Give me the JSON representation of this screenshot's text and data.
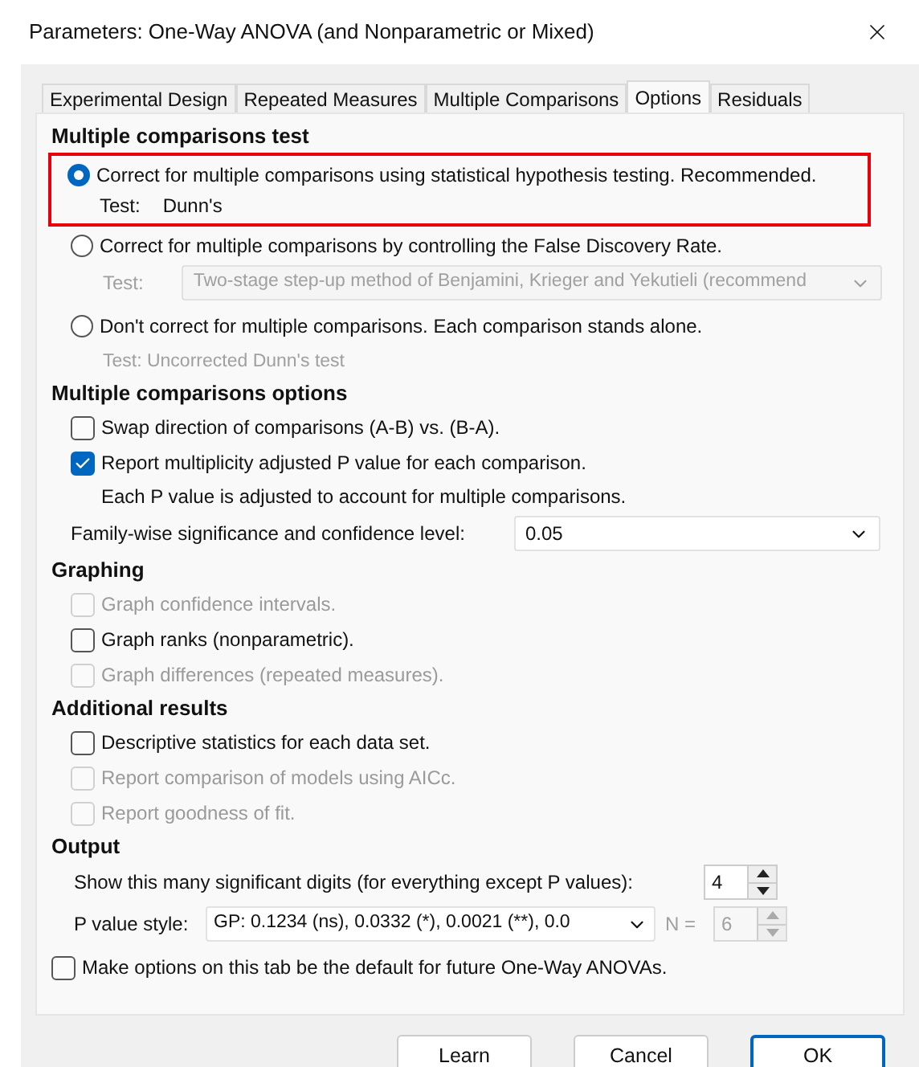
{
  "window": {
    "title": "Parameters: One-Way ANOVA (and Nonparametric or Mixed)"
  },
  "tabs": [
    {
      "label": "Experimental Design",
      "selected": false
    },
    {
      "label": "Repeated Measures",
      "selected": false
    },
    {
      "label": "Multiple Comparisons",
      "selected": false
    },
    {
      "label": "Options",
      "selected": true
    },
    {
      "label": "Residuals",
      "selected": false
    }
  ],
  "sections": [
    {
      "heading": "Multiple comparisons test",
      "items": [
        {
          "kind": "radio",
          "label": "Correct for multiple comparisons using statistical hypothesis testing. Recommended.",
          "selected": true,
          "highlighted": true,
          "test_label": "Test:",
          "test_value": "Dunn's"
        },
        {
          "kind": "radio",
          "label": "Correct for multiple comparisons by controlling the False Discovery Rate.",
          "selected": false,
          "highlighted": false,
          "test_label": "Test:",
          "test_select": {
            "value": "Two-stage step-up method of Benjamini, Krieger and Yekutieli (recommend",
            "disabled": true
          }
        },
        {
          "kind": "radio",
          "label": "Don't correct for multiple comparisons. Each comparison stands alone.",
          "selected": false,
          "highlighted": false,
          "note": "Test: Uncorrected Dunn's test"
        }
      ]
    },
    {
      "heading": "Multiple comparisons options",
      "items": [
        {
          "kind": "checkbox",
          "label": "Swap direction of comparisons (A-B) vs. (B-A).",
          "checked": false,
          "disabled": false
        },
        {
          "kind": "checkbox",
          "label": "Report multiplicity adjusted P value for each comparison.",
          "checked": true,
          "disabled": false,
          "note": "Each P value is adjusted to account for multiple comparisons."
        },
        {
          "kind": "select",
          "label": "Family-wise significance and confidence level:",
          "value": "0.05"
        }
      ]
    },
    {
      "heading": "Graphing",
      "items": [
        {
          "kind": "checkbox",
          "label": "Graph confidence intervals.",
          "checked": false,
          "disabled": true
        },
        {
          "kind": "checkbox",
          "label": "Graph ranks (nonparametric).",
          "checked": false,
          "disabled": false
        },
        {
          "kind": "checkbox",
          "label": "Graph differences (repeated measures).",
          "checked": false,
          "disabled": true
        }
      ]
    },
    {
      "heading": "Additional results",
      "items": [
        {
          "kind": "checkbox",
          "label": "Descriptive statistics for each data set.",
          "checked": false,
          "disabled": false
        },
        {
          "kind": "checkbox",
          "label": "Report comparison of models using AICc.",
          "checked": false,
          "disabled": true
        },
        {
          "kind": "checkbox",
          "label": "Report goodness of fit.",
          "checked": false,
          "disabled": true
        }
      ]
    },
    {
      "heading": "Output",
      "items": [
        {
          "kind": "spinner",
          "label": "Show this many significant digits (for everything except P values):",
          "value": "4"
        },
        {
          "kind": "pvalue",
          "label": "P value style:",
          "value": "GP: 0.1234 (ns), 0.0332 (*), 0.0021 (**), 0.0",
          "n_label": "N =",
          "n_value": "6",
          "n_disabled": true
        }
      ]
    }
  ],
  "default_option": {
    "label": "Make options on this tab be the default for future One-Way ANOVAs.",
    "checked": false
  },
  "buttons": [
    {
      "label": "Learn",
      "default": false
    },
    {
      "label": "Cancel",
      "default": false
    },
    {
      "label": "OK",
      "default": true
    }
  ]
}
